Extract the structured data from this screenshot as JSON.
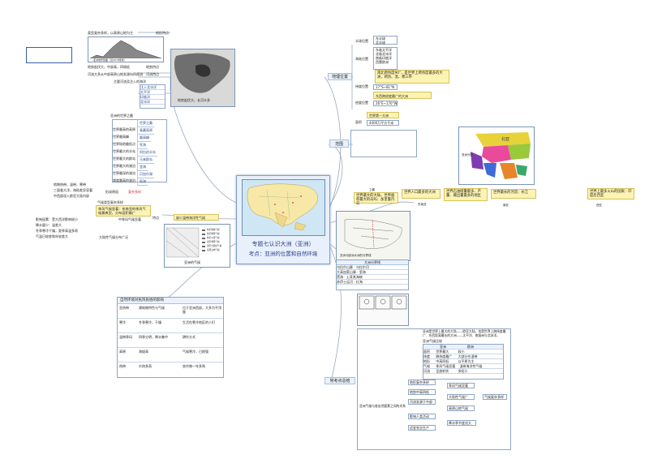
{
  "center": {
    "title1": "专题七认识大洲（亚洲）",
    "title2": "考点：亚洲的位置和自然环境"
  },
  "branches": {
    "geo": "地理位置",
    "range": "范围",
    "features": "特点",
    "exam": "常考点总结"
  },
  "geo": {
    "haf_label": "半球位置",
    "haf": [
      "东半球",
      "北半球"
    ],
    "sea_label": "海陆位置",
    "sea": [
      "东临太平洋",
      "北临北冰洋",
      "南临印度洋",
      "西靠欧洲"
    ],
    "lat_label": "纬度位置",
    "lat": "南北跨纬度90°，是世界上跨纬度最多的大洲，跨热、温、寒三带",
    "lon_label": "经度位置",
    "lon": "东西跨经度最广的大洲",
    "lat_range": "17°S~81°N",
    "lon_range": "26°E~170°W",
    "area_label": "面积",
    "area_value": "4400万平方千米",
    "area_rank": "世界第一大洲"
  },
  "range": {
    "map_caption": "亚洲分区"
  },
  "facts": {
    "tag1": "之最",
    "f1": "世界最大的大陆，世界面积最大的岛屿：加里曼丹岛",
    "f2": "世界人口最多的大洲",
    "f3": "世界石油储量最多、产量、输出量最多的地区",
    "f4": "世界最长的河流：长江",
    "f5": "世界上最多火山的国家：印度尼西亚",
    "tag2": "东南亚",
    "tag3": "南亚",
    "tag4": "西亚"
  },
  "left_top": {
    "r1": "类型复杂多样，以高原山地为主",
    "r1b": "地形特点",
    "r2": "地势起伏大，中部高，四周低",
    "r2b": "地势特点",
    "r3": "河流大多从中部高原山地发源向四周流",
    "r3b": "河流特点",
    "r4": "主要河流及注入的海洋",
    "oceans": [
      "注入北冰洋",
      "太平洋",
      "印度洋",
      "北冰洋"
    ],
    "map_caption": "地势起伏大，长河众多",
    "profile_caption": "亚洲地形剖面（沿30°N纬线）"
  },
  "superlatives": {
    "header": "亚洲的世界之最",
    "items": [
      "世界之最",
      "青藏高原",
      "最高峰",
      "死海",
      "阿拉伯半岛",
      "马来群岛",
      "里海",
      "贝加尔湖",
      "死海"
    ],
    "names": [
      "",
      "世界最高的高原",
      "世界最高峰",
      "世界陆地最低点",
      "世界最大的半岛",
      "世界最大的群岛",
      "世界最大的湖泊",
      "世界最深的湖泊",
      "咸度最高的湖泊"
    ]
  },
  "climate": {
    "t1": "地跨热带、温带、寒带",
    "t2": "三面临大洋，海陆差异显著",
    "t3": "中西部深入欧亚大陆内部",
    "t4": "形成原因",
    "t5": "复杂多样",
    "t6": "气候类型复杂多样",
    "mon": "季风气候显著：东南亚的季风气候最典型，分布面积最广",
    "t8": "中季风气候显著",
    "t9": "大陆性气候分布广泛",
    "label": "特点",
    "lack": "缺少温带海洋性气候",
    "map_caption": "亚洲的气候",
    "notes": [
      "影响因素：受大西洋影响较小",
      "降水量少：温差大",
      "冬季寒冷干燥，夏季高温多雨",
      "气温日较差和年较差大"
    ],
    "legend": [
      "热带雨林气候",
      "热带季风气候",
      "热带沙漠气候",
      "温带季风气候",
      "温带大陆性气候",
      "高原山地气候",
      "亚热带季风气候",
      "地中海气候",
      "苔原气候"
    ]
  },
  "border": {
    "map_caption": "亚洲与欧洲大洲的分界线",
    "header": "大洲分界线",
    "rows": [
      [
        "乌拉尔山脉",
        "乌拉尔河"
      ],
      [
        "大高加索山脉",
        "里海"
      ],
      [
        "黑海",
        "土耳其海峡"
      ],
      [
        "苏伊士运河",
        "红海"
      ]
    ]
  },
  "table": {
    "title": "自然环境对民风民俗的影响",
    "rows": [
      [
        "亚热带",
        "建筑物特色与气候",
        "位于亚洲西部，大多为平顶屋"
      ],
      [
        "寒冷",
        "冬季寒冷，干燥",
        "生活在寒冷地区的人们"
      ],
      [
        "温带季风",
        "四季分明，降水集中",
        "耕作方式"
      ],
      [
        "高原",
        "海拔高",
        "气候寒冷，日照强"
      ],
      [
        "热带",
        "炎热多雨",
        "农作物一年多熟"
      ]
    ]
  },
  "exam": {
    "line1": "亚洲是世界上最大的大陆——欧亚大陆，也是世界上跨纬度最广、东西距离最长的大洲——太平洋、南极洲与北冰洋。",
    "cmp_title": "亚洲气候比较",
    "cmp_header": [
      "",
      "亚洲",
      "欧洲"
    ],
    "cmp_rows": [
      [
        "面积",
        "世界最大",
        "较小"
      ],
      [
        "纬度",
        "跨纬度最广",
        "大部分在温带"
      ],
      [
        "地形",
        "中高四低",
        "以平原为主"
      ],
      [
        "气候",
        "季风气候显著",
        "温带海洋性气候"
      ],
      [
        "河流",
        "呈放射状",
        "多短小"
      ]
    ],
    "flow_title": "亚洲气候与各自然要素之间的关系",
    "flow": [
      "地形复杂多样",
      "地势中高四低",
      "河流发源于中部",
      "季风气候显著",
      "大陆性气候广",
      "高原山地气候",
      "影响人类活动",
      "适宜农业生产",
      "降水季节变化大",
      "气候复杂多样"
    ]
  },
  "colors": {
    "accent": "#2b3f8a",
    "highlight": "#fdf3b2",
    "center": "#e8f0fb",
    "line": "#9aa8bf"
  },
  "icons": [
    "compass-icon",
    "map-icon"
  ]
}
